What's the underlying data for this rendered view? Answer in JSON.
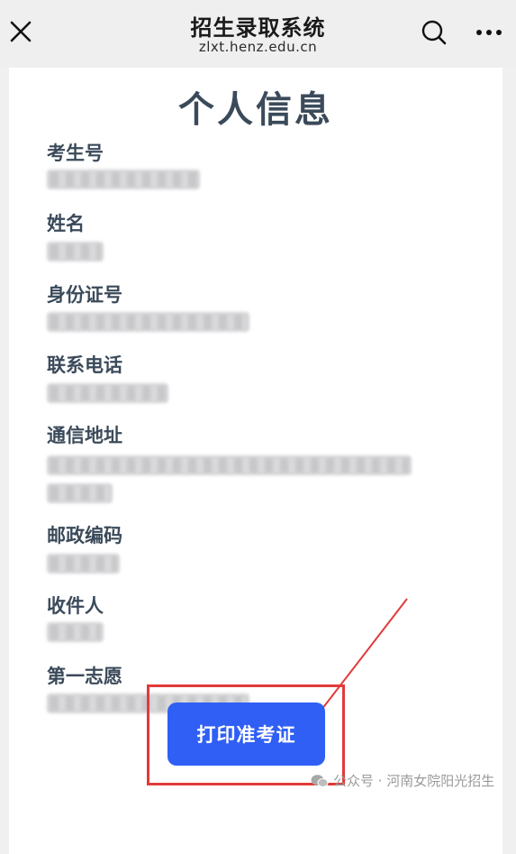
{
  "header": {
    "title": "招生录取系统",
    "domain": "zlxt.henz.edu.cn"
  },
  "page": {
    "title": "个人信息"
  },
  "fields": [
    {
      "label": "考生号"
    },
    {
      "label": "姓名"
    },
    {
      "label": "身份证号"
    },
    {
      "label": "联系电话"
    },
    {
      "label": "通信地址"
    },
    {
      "label": "邮政编码"
    },
    {
      "label": "收件人"
    },
    {
      "label": "第一志愿"
    }
  ],
  "actions": {
    "print_label": "打印准考证"
  },
  "watermark": {
    "text": "公众号 · 河南女院阳光招生"
  },
  "colors": {
    "accent": "#2f5ff5",
    "annotation": "#e23a3a",
    "label": "#3b4a5a"
  },
  "icons": [
    "close-icon",
    "search-icon",
    "more-icon",
    "wechat-icon",
    "arrow-annotation"
  ]
}
